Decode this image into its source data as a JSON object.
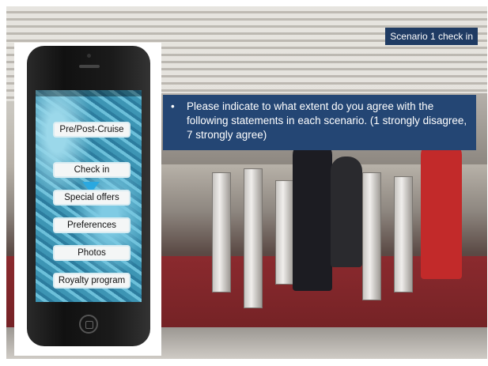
{
  "slide": {
    "title": "Scenario 1 check in",
    "instruction": "Please indicate to what extent do you agree with the following statements in each scenario. (1 strongly disagree, 7 strongly agree)"
  },
  "phone": {
    "menu": [
      {
        "label": "Pre/Post-Cruise"
      },
      {
        "label": "Check in"
      },
      {
        "label": "Special offers"
      },
      {
        "label": "Preferences"
      },
      {
        "label": "Photos"
      },
      {
        "label": "Royalty program"
      }
    ]
  },
  "colors": {
    "title_box": "#1f3b63",
    "instruction_box": "#244674",
    "arrow": "#2aa8e0"
  }
}
